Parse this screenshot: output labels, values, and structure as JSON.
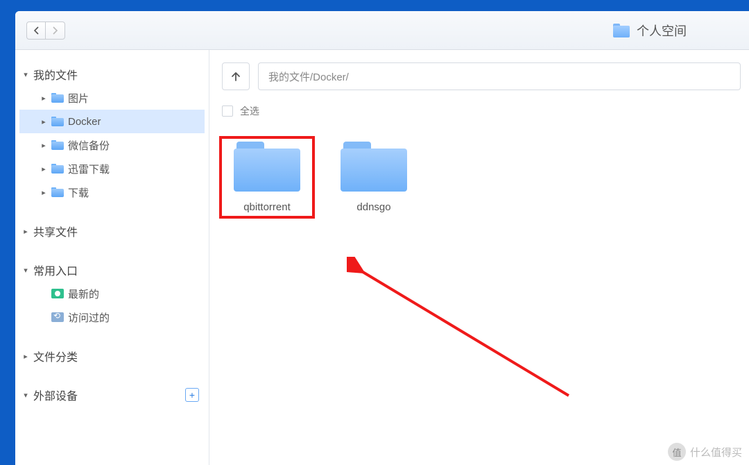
{
  "header": {
    "title": "个人空间"
  },
  "sidebar": {
    "my_files": {
      "label": "我的文件",
      "items": [
        {
          "label": "图片"
        },
        {
          "label": "Docker"
        },
        {
          "label": "微信备份"
        },
        {
          "label": "迅雷下载"
        },
        {
          "label": "下载"
        }
      ]
    },
    "shared": {
      "label": "共享文件"
    },
    "shortcuts": {
      "label": "常用入口",
      "items": [
        {
          "label": "最新的"
        },
        {
          "label": "访问过的"
        }
      ]
    },
    "categories": {
      "label": "文件分类"
    },
    "external": {
      "label": "外部设备"
    }
  },
  "main": {
    "path": "我的文件/Docker/",
    "select_all": "全选",
    "items": [
      {
        "name": "qbittorrent"
      },
      {
        "name": "ddnsgo"
      }
    ]
  },
  "watermark": {
    "badge": "值",
    "text": "什么值得买"
  }
}
